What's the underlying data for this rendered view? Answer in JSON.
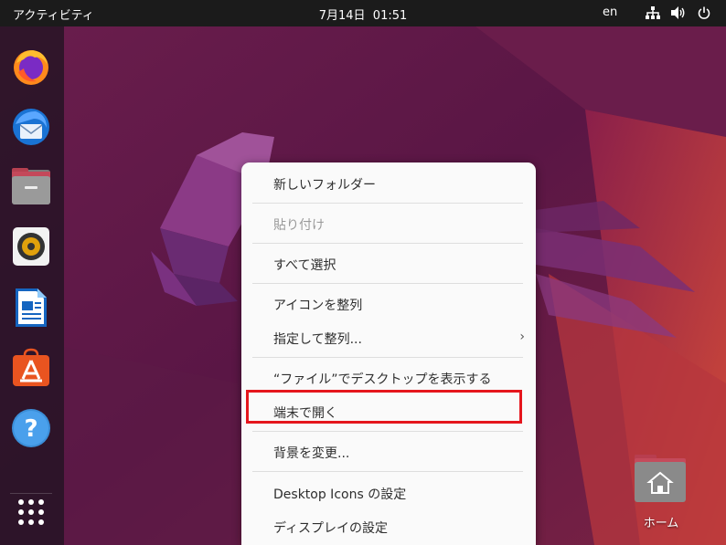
{
  "topbar": {
    "activities": "アクティビティ",
    "clock": "7月14日  01:51",
    "lang": "en"
  },
  "dock": {
    "items": [
      "firefox-icon",
      "thunderbird-icon",
      "files-icon",
      "rhythmbox-icon",
      "libreoffice-writer-icon",
      "software-center-icon",
      "help-icon"
    ]
  },
  "menu": {
    "new_folder": "新しいフォルダー",
    "paste": "貼り付け",
    "select_all": "すべて選択",
    "arrange_icons": "アイコンを整列",
    "arrange_by": "指定して整列...",
    "show_in_files": "“ファイル”でデスクトップを表示する",
    "open_terminal": "端末で開く",
    "change_background": "背景を変更...",
    "desktop_icons_settings": "Desktop Icons の設定",
    "display_settings": "ディスプレイの設定",
    "submenu_glyph": "›"
  },
  "desktop": {
    "home_label": "ホーム"
  },
  "colors": {
    "highlight": "#e5161d",
    "topbar": "#1b1b1b",
    "menu_bg": "#fafafa"
  }
}
